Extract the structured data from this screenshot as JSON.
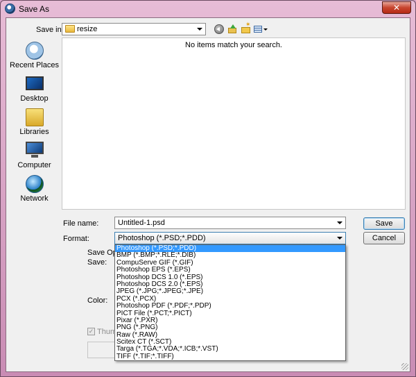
{
  "window": {
    "title": "Save As",
    "close_glyph": "✕",
    "icons": {
      "app": "photoshop-globe-icon",
      "close": "close-icon"
    }
  },
  "toolbar": {
    "save_in_label": "Save in:",
    "save_in_value": "resize",
    "icons": [
      "back-icon",
      "up-folder-icon",
      "new-folder-icon",
      "views-menu-icon"
    ]
  },
  "places": [
    {
      "label": "Recent Places",
      "icon": "recent-places-icon"
    },
    {
      "label": "Desktop",
      "icon": "desktop-icon"
    },
    {
      "label": "Libraries",
      "icon": "libraries-icon"
    },
    {
      "label": "Computer",
      "icon": "computer-icon"
    },
    {
      "label": "Network",
      "icon": "network-icon"
    }
  ],
  "file_list": {
    "empty_message": "No items match your search."
  },
  "file_name": {
    "label": "File name:",
    "value": "Untitled-1.psd"
  },
  "format": {
    "label": "Format:",
    "value": "Photoshop (*.PSD;*.PDD)",
    "options": [
      "Photoshop (*.PSD;*.PDD)",
      "BMP (*.BMP;*.RLE;*.DIB)",
      "CompuServe GIF (*.GIF)",
      "Photoshop EPS (*.EPS)",
      "Photoshop DCS 1.0 (*.EPS)",
      "Photoshop DCS 2.0 (*.EPS)",
      "JPEG (*.JPG;*.JPEG;*.JPE)",
      "PCX (*.PCX)",
      "Photoshop PDF (*.PDF;*.PDP)",
      "PICT File (*.PCT;*.PICT)",
      "Pixar (*.PXR)",
      "PNG (*.PNG)",
      "Raw (*.RAW)",
      "Scitex CT (*.SCT)",
      "Targa (*.TGA;*.VDA;*.ICB;*.VST)",
      "TIFF (*.TIF;*.TIFF)"
    ],
    "selected_index": 0
  },
  "buttons": {
    "save": "Save",
    "cancel": "Cancel"
  },
  "save_options": {
    "heading": "Save Opti",
    "save_label": "Save:",
    "color_label": "Color:",
    "thumbnail_label": "Thumb",
    "thumbnail_checked": true,
    "check_glyph": "✓"
  },
  "colors": {
    "selection": "#3399ff",
    "frame": "#c98cb4",
    "close": "#c7452f"
  }
}
